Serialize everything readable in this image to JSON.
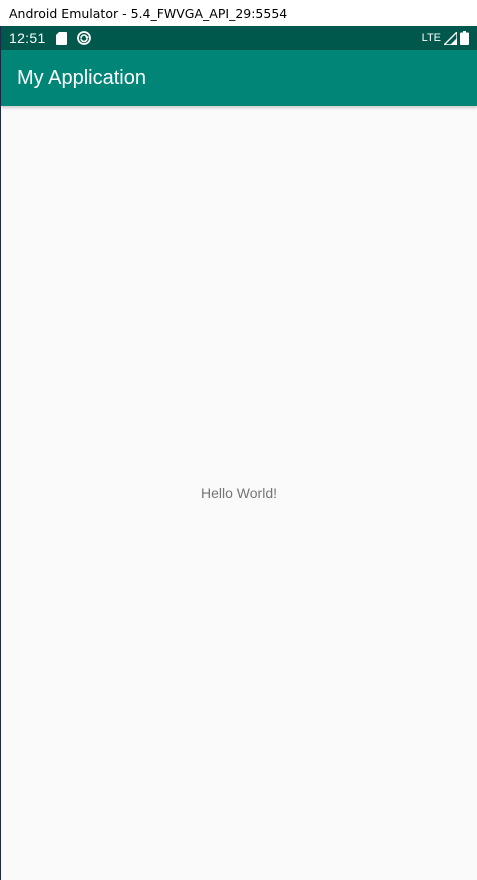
{
  "window": {
    "title": "Android Emulator - 5.4_FWVGA_API_29:5554"
  },
  "status_bar": {
    "time": "12:51",
    "left_icons": [
      "sd-card-icon",
      "sync-icon"
    ],
    "network_label": "LTE",
    "right_icons": [
      "signal-icon",
      "battery-icon"
    ]
  },
  "app_bar": {
    "title": "My Application"
  },
  "content": {
    "text": "Hello World!"
  },
  "colors": {
    "status_bar": "#00574b",
    "app_bar": "#008577",
    "background": "#fafafa",
    "body_text": "#757575"
  }
}
